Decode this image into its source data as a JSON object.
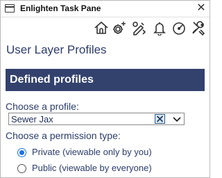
{
  "window": {
    "title": "Enlighten Task Pane",
    "close_glyph": "✕"
  },
  "toolbar": {
    "icons": [
      "home-icon",
      "settings-sparkle-icon",
      "edit-tools-icon",
      "bell-icon",
      "gauge-icon",
      "tools-icon"
    ]
  },
  "main": {
    "heading": "User Layer Profiles",
    "section_title": "Defined profiles",
    "profile_label": "Choose a profile:",
    "profile_value": "Sewer Jax",
    "permission_label": "Choose a permission type:",
    "permissions": [
      {
        "label": "Private (viewable only by you)",
        "checked": true
      },
      {
        "label": "Public (viewable by everyone)",
        "checked": false
      }
    ]
  },
  "colors": {
    "heading": "#2c3d6c",
    "banner": "#33426d",
    "radio_accent": "#1a73e8"
  }
}
